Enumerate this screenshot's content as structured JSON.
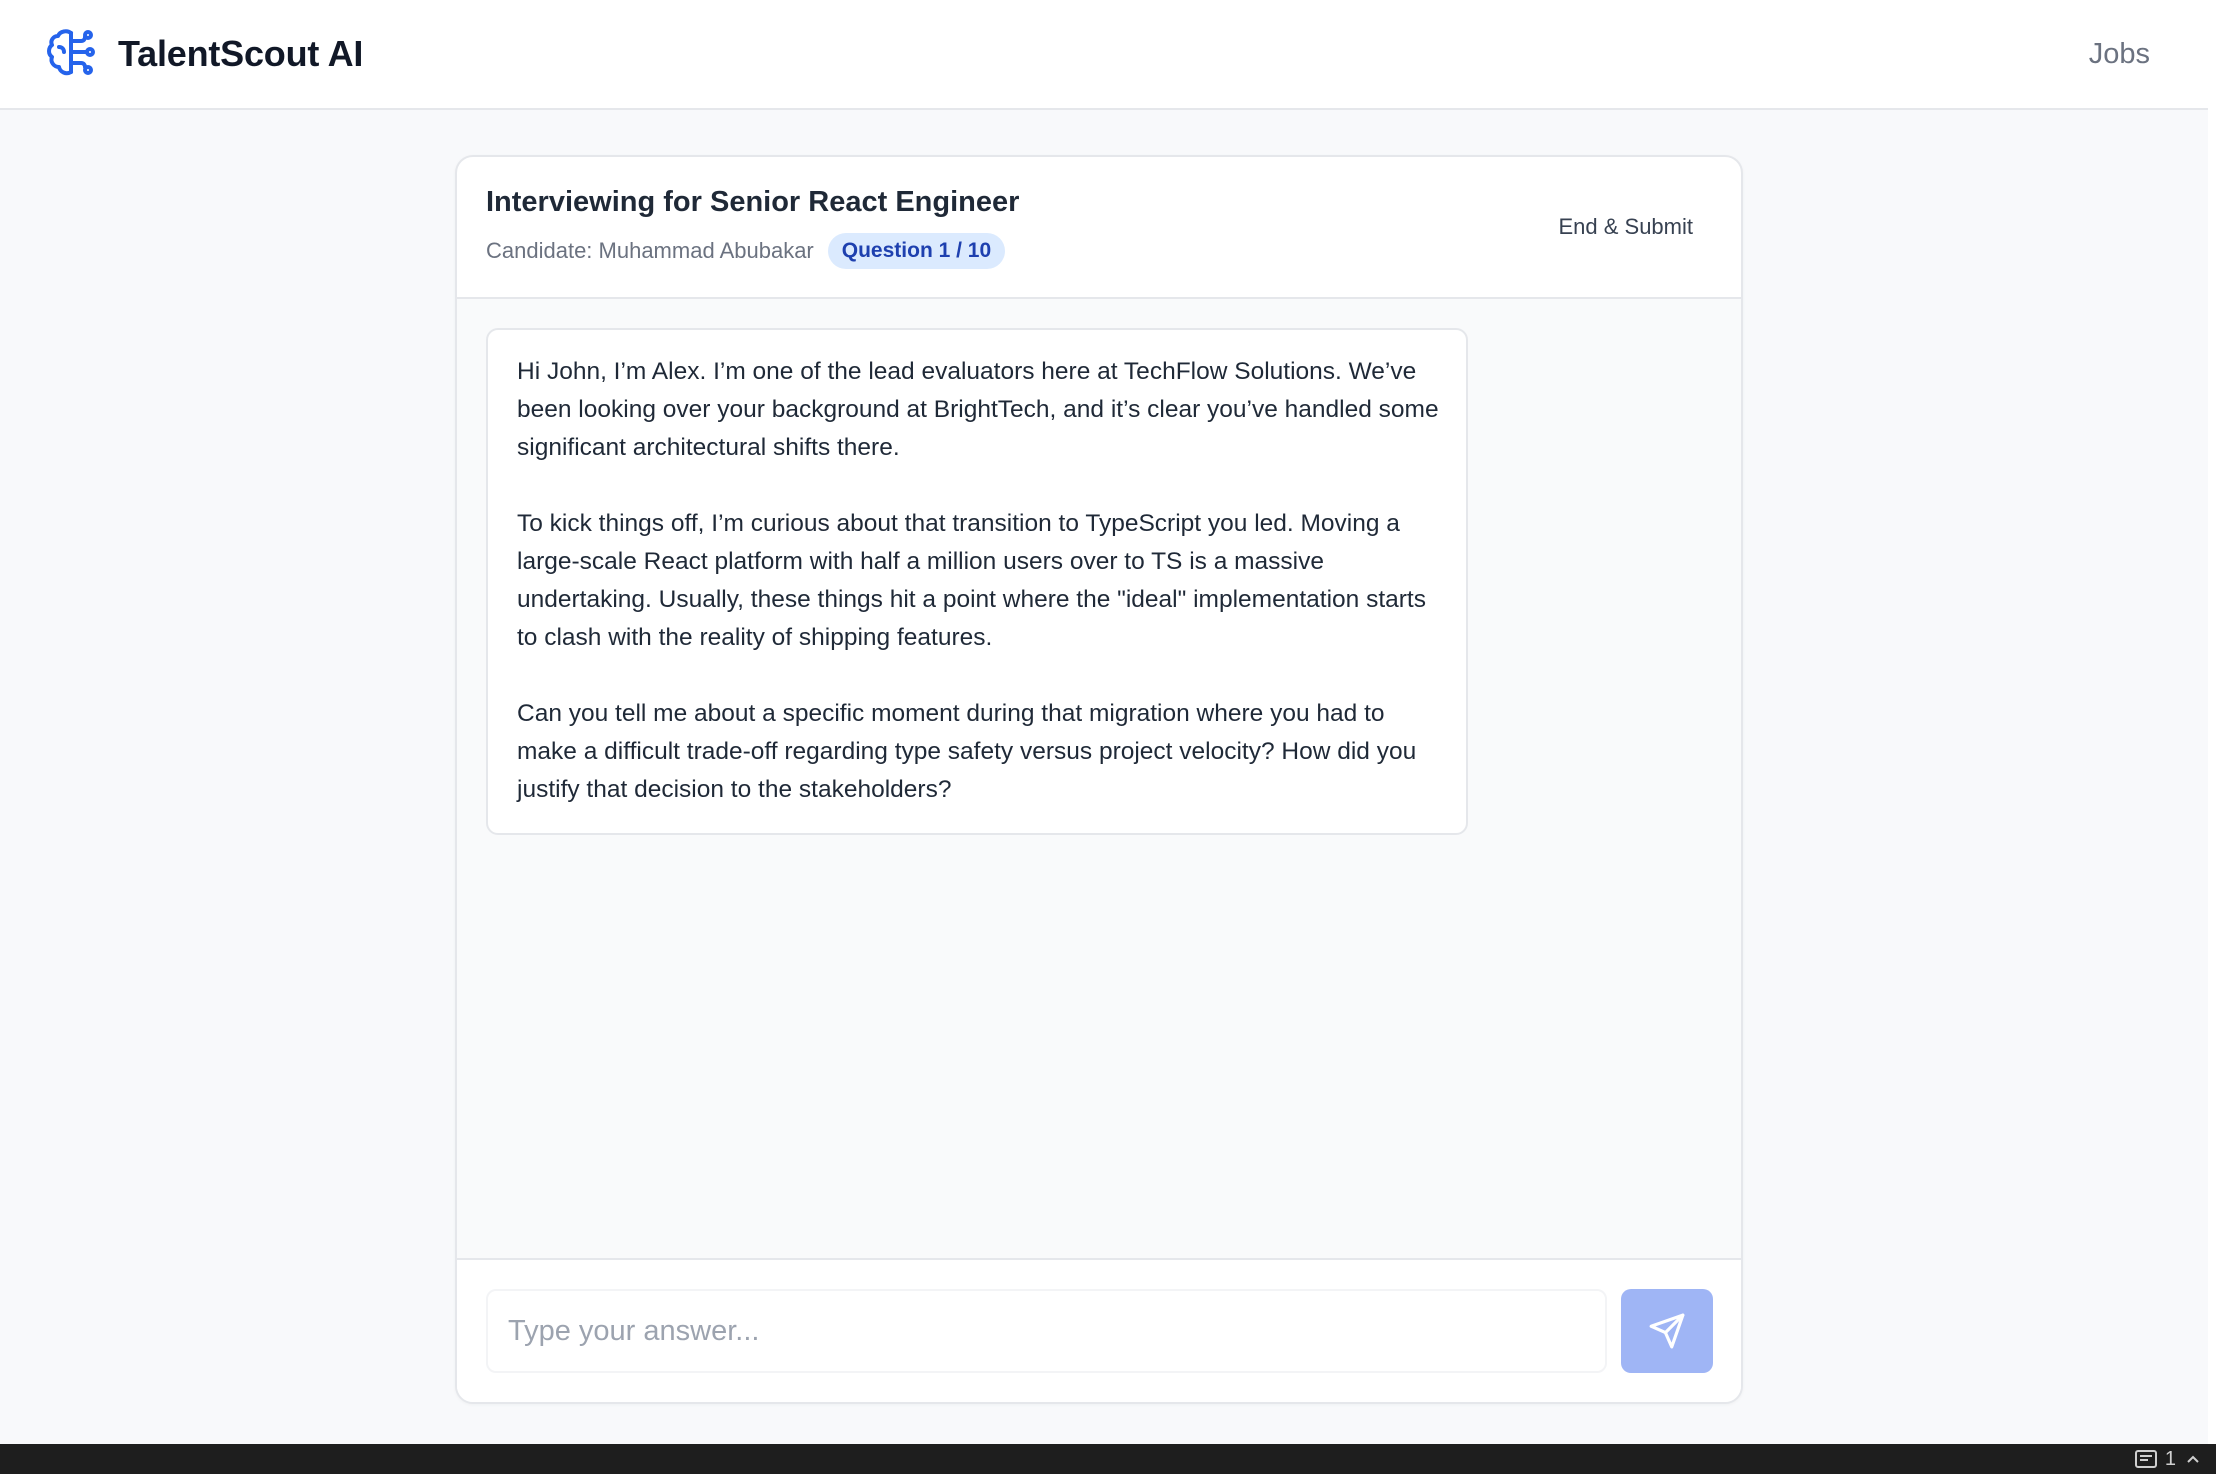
{
  "app": {
    "name": "TalentScout AI",
    "nav_jobs": "Jobs"
  },
  "interview": {
    "title": "Interviewing for Senior React Engineer",
    "candidate": "Candidate: Muhammad Abubakar",
    "progress_badge": "Question 1 / 10",
    "end_button": "End & Submit"
  },
  "messages": [
    {
      "role": "interviewer",
      "paragraphs": [
        "Hi John, I’m Alex. I’m one of the lead evaluators here at TechFlow Solutions. We’ve been looking over your background at BrightTech, and it’s clear you’ve handled some significant architectural shifts there.",
        "To kick things off, I’m curious about that transition to TypeScript you led. Moving a large-scale React platform with half a million users over to TS is a massive undertaking. Usually, these things hit a point where the \"ideal\" implementation starts to clash with the reality of shipping features.",
        "Can you tell me about a specific moment during that migration where you had to make a difficult trade-off regarding type safety versus project velocity? How did you justify that decision to the stakeholders?"
      ]
    }
  ],
  "composer": {
    "placeholder": "Type your answer...",
    "value": ""
  },
  "statusbar": {
    "count": "1"
  },
  "icons": {
    "logo": "brain-icon",
    "send": "send-icon"
  },
  "colors": {
    "brand": "#2563eb",
    "badge_bg": "#dbeafe",
    "badge_text": "#1e40af",
    "send_button": "#9fb5f5"
  }
}
